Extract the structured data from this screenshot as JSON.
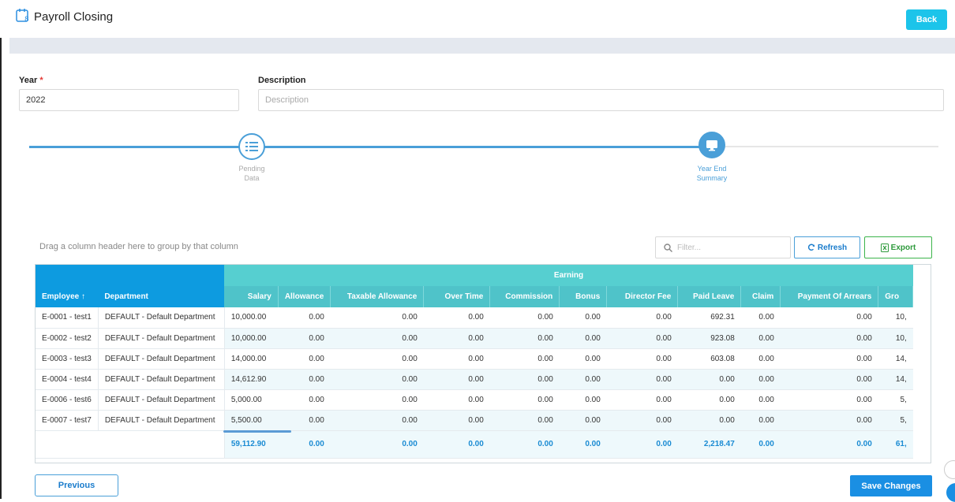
{
  "header": {
    "title": "Payroll Closing",
    "back_label": "Back",
    "title_icon": "calendar-icon"
  },
  "form": {
    "year_label": "Year",
    "year_required": "*",
    "year_value": "2022",
    "description_label": "Description",
    "description_placeholder": "Description",
    "description_value": ""
  },
  "steps": [
    {
      "label_line1": "Pending",
      "label_line2": "Data",
      "icon": "list-icon",
      "state": "done"
    },
    {
      "label_line1": "Year End",
      "label_line2": "Summary",
      "icon": "monitor-icon",
      "state": "active"
    }
  ],
  "grid": {
    "group_hint": "Drag a column header here to group by that column",
    "filter_placeholder": "Filter...",
    "refresh_label": "Refresh",
    "export_label": "Export",
    "band_header": "Earning",
    "frozen_headers": [
      "Employee",
      "Department"
    ],
    "sort_indicator": "↑",
    "columns": [
      "Salary",
      "Allowance",
      "Taxable Allowance",
      "Over Time",
      "Commission",
      "Bonus",
      "Director Fee",
      "Paid Leave",
      "Claim",
      "Payment Of Arrears",
      "Gro"
    ],
    "rows": [
      {
        "employee": "E-0001 - test1",
        "department": "DEFAULT - Default Department",
        "values": [
          "10,000.00",
          "0.00",
          "0.00",
          "0.00",
          "0.00",
          "0.00",
          "0.00",
          "692.31",
          "0.00",
          "0.00",
          "10,"
        ]
      },
      {
        "employee": "E-0002 - test2",
        "department": "DEFAULT - Default Department",
        "values": [
          "10,000.00",
          "0.00",
          "0.00",
          "0.00",
          "0.00",
          "0.00",
          "0.00",
          "923.08",
          "0.00",
          "0.00",
          "10,"
        ]
      },
      {
        "employee": "E-0003 - test3",
        "department": "DEFAULT - Default Department",
        "values": [
          "14,000.00",
          "0.00",
          "0.00",
          "0.00",
          "0.00",
          "0.00",
          "0.00",
          "603.08",
          "0.00",
          "0.00",
          "14,"
        ]
      },
      {
        "employee": "E-0004 - test4",
        "department": "DEFAULT - Default Department",
        "values": [
          "14,612.90",
          "0.00",
          "0.00",
          "0.00",
          "0.00",
          "0.00",
          "0.00",
          "0.00",
          "0.00",
          "0.00",
          "14,"
        ]
      },
      {
        "employee": "E-0006 - test6",
        "department": "DEFAULT - Default Department",
        "values": [
          "5,000.00",
          "0.00",
          "0.00",
          "0.00",
          "0.00",
          "0.00",
          "0.00",
          "0.00",
          "0.00",
          "0.00",
          "5,"
        ]
      },
      {
        "employee": "E-0007 - test7",
        "department": "DEFAULT - Default Department",
        "values": [
          "5,500.00",
          "0.00",
          "0.00",
          "0.00",
          "0.00",
          "0.00",
          "0.00",
          "0.00",
          "0.00",
          "0.00",
          "5,"
        ]
      }
    ],
    "totals": [
      "59,112.90",
      "0.00",
      "0.00",
      "0.00",
      "0.00",
      "0.00",
      "0.00",
      "2,218.47",
      "0.00",
      "0.00",
      "61,"
    ]
  },
  "footer": {
    "previous_label": "Previous",
    "save_label": "Save Changes"
  },
  "colors": {
    "primary": "#1a8fe3",
    "frozen_header": "#0d9be0",
    "earning_header": "#4fc3c9",
    "accent_cyan": "#1cc4ea"
  }
}
